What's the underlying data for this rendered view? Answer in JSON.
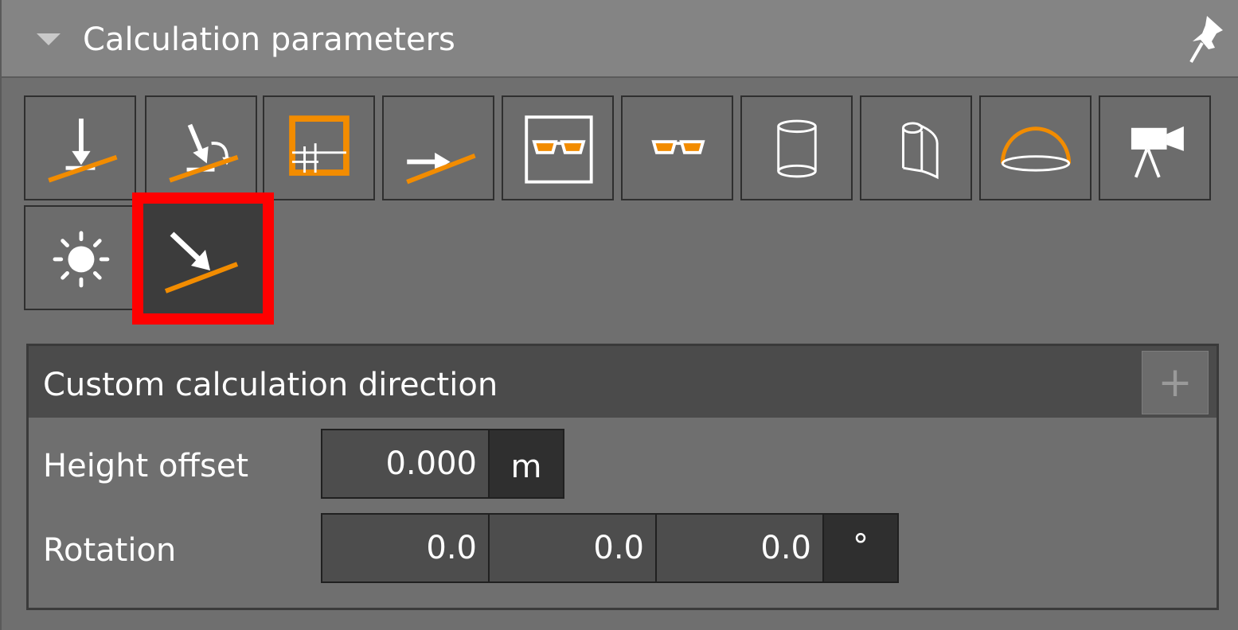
{
  "header": {
    "title": "Calculation parameters"
  },
  "toolbar": {
    "buttons": [
      {
        "name": "vertical-calculation-direction"
      },
      {
        "name": "perpendicular-calculation-direction"
      },
      {
        "name": "grid-calculation"
      },
      {
        "name": "horizontal-calculation-direction"
      },
      {
        "name": "ugr-observer-framed"
      },
      {
        "name": "ugr-observer"
      },
      {
        "name": "cylindrical-illuminance"
      },
      {
        "name": "semi-cylindrical-illuminance"
      },
      {
        "name": "hemispherical-illuminance"
      },
      {
        "name": "camera-viewpoint"
      },
      {
        "name": "daylight"
      },
      {
        "name": "custom-calculation-direction",
        "selected": true
      }
    ],
    "colors": {
      "accent": "#f28c00",
      "selection": "#ff0000"
    }
  },
  "section": {
    "title": "Custom calculation direction",
    "add_label": "+",
    "height_offset": {
      "label": "Height offset",
      "value": "0.000",
      "unit": "m"
    },
    "rotation": {
      "label": "Rotation",
      "x": "0.0",
      "y": "0.0",
      "z": "0.0",
      "unit": "°"
    }
  }
}
